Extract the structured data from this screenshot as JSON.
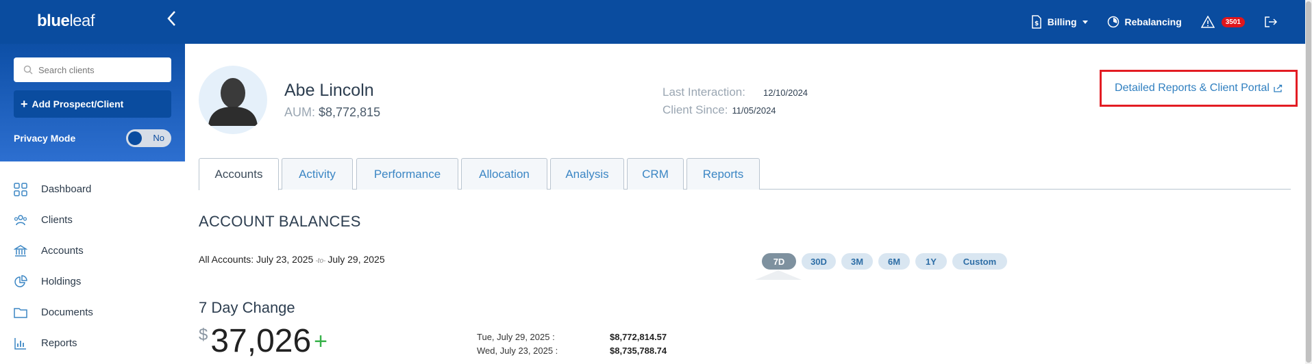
{
  "brand": {
    "bold": "blue",
    "light": "leaf"
  },
  "topnav": {
    "billing": "Billing",
    "rebalancing": "Rebalancing",
    "alert_count": "3501"
  },
  "sidebar": {
    "search_placeholder": "Search clients",
    "add_button": "Add Prospect/Client",
    "privacy_label": "Privacy Mode",
    "privacy_value": "No",
    "items": [
      {
        "label": "Dashboard",
        "icon": "dashboard-icon"
      },
      {
        "label": "Clients",
        "icon": "clients-icon"
      },
      {
        "label": "Accounts",
        "icon": "bank-icon"
      },
      {
        "label": "Holdings",
        "icon": "pie-chart-icon"
      },
      {
        "label": "Documents",
        "icon": "folder-icon"
      },
      {
        "label": "Reports",
        "icon": "bar-chart-icon"
      }
    ]
  },
  "client": {
    "name": "Abe Lincoln",
    "aum_label": "AUM:",
    "aum_value": "$8,772,815",
    "last_interaction_label": "Last Interaction:",
    "last_interaction_value": "12/10/2024",
    "client_since_label": "Client Since:",
    "client_since_value": "11/05/2024",
    "report_link": "Detailed Reports & Client Portal"
  },
  "tabs": [
    {
      "label": "Accounts",
      "active": true
    },
    {
      "label": "Activity",
      "active": false
    },
    {
      "label": "Performance",
      "active": false
    },
    {
      "label": "Allocation",
      "active": false
    },
    {
      "label": "Analysis",
      "active": false
    },
    {
      "label": "CRM",
      "active": false
    },
    {
      "label": "Reports",
      "active": false
    }
  ],
  "balances": {
    "title": "ACCOUNT BALANCES",
    "range_prefix": "All Accounts:",
    "range_start": "July 23, 2025",
    "range_sep": "-to-",
    "range_end": "July 29, 2025",
    "periods": [
      {
        "label": "7D",
        "active": true
      },
      {
        "label": "30D",
        "active": false
      },
      {
        "label": "3M",
        "active": false
      },
      {
        "label": "6M",
        "active": false
      },
      {
        "label": "1Y",
        "active": false
      },
      {
        "label": "Custom",
        "active": false
      }
    ],
    "change_title": "7 Day Change",
    "change_currency": "$",
    "change_value": "37,026",
    "change_sign": "+",
    "rows": [
      {
        "date": "Tue, July 29, 2025 :",
        "amount": "$8,772,814.57"
      },
      {
        "date": "Wed, July 23, 2025 :",
        "amount": "$8,735,788.74"
      }
    ]
  },
  "colors": {
    "primary": "#0a4c9f",
    "link": "#2f7fc0",
    "highlight_border": "#e31c23",
    "positive": "#38b24a",
    "badge": "#e0161c"
  }
}
